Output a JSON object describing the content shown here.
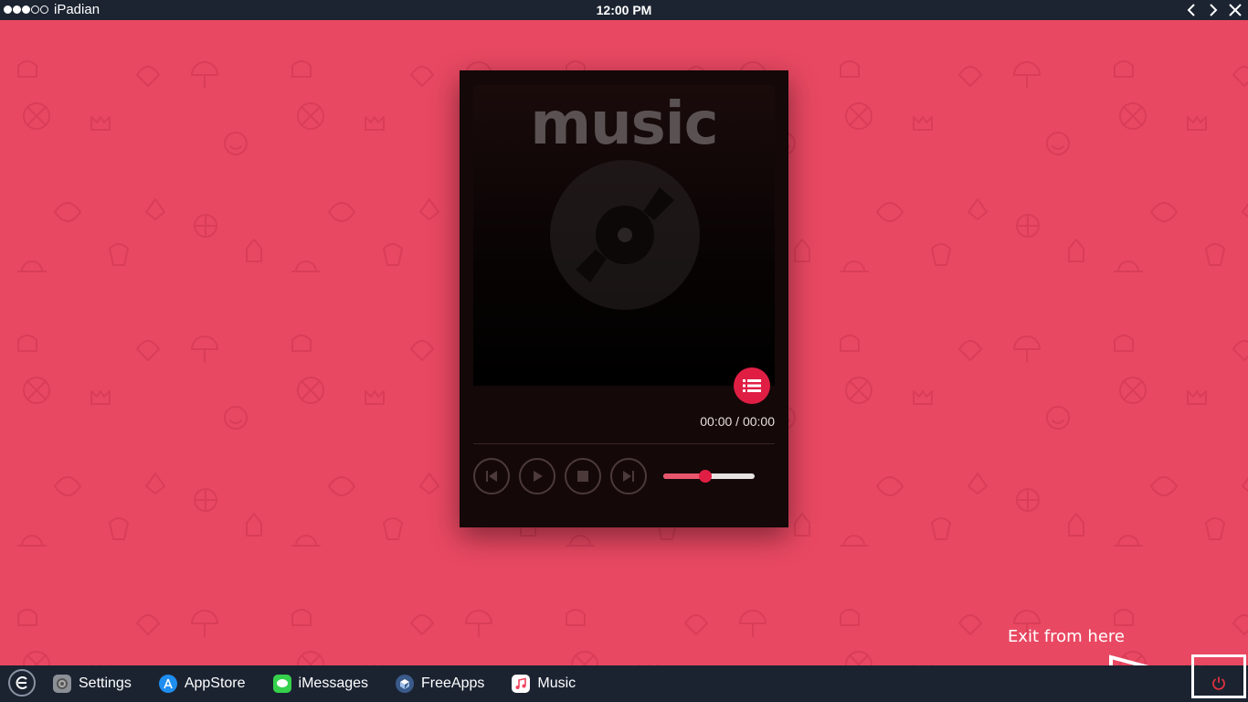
{
  "status_bar": {
    "carrier": "iPadian",
    "signal_filled": 3,
    "signal_total": 5,
    "time": "12:00 PM"
  },
  "window_controls": {
    "back_icon": "chevron-left-icon",
    "forward_icon": "chevron-right-icon",
    "close_icon": "close-icon"
  },
  "player": {
    "title": "music",
    "time": "00:00 / 00:00",
    "volume": 0.46,
    "accent": "#e01e44",
    "background": "#140808"
  },
  "annotation": {
    "text": "Exit from here"
  },
  "taskbar": {
    "items": [
      {
        "label": "Settings",
        "icon": "settings-icon"
      },
      {
        "label": "AppStore",
        "icon": "appstore-icon"
      },
      {
        "label": "iMessages",
        "icon": "imessages-icon"
      },
      {
        "label": "FreeApps",
        "icon": "freeapps-icon"
      },
      {
        "label": "Music",
        "icon": "music-icon"
      }
    ],
    "power_icon": "power-icon"
  },
  "colors": {
    "background": "#e94862",
    "bar": "#1b2331"
  }
}
